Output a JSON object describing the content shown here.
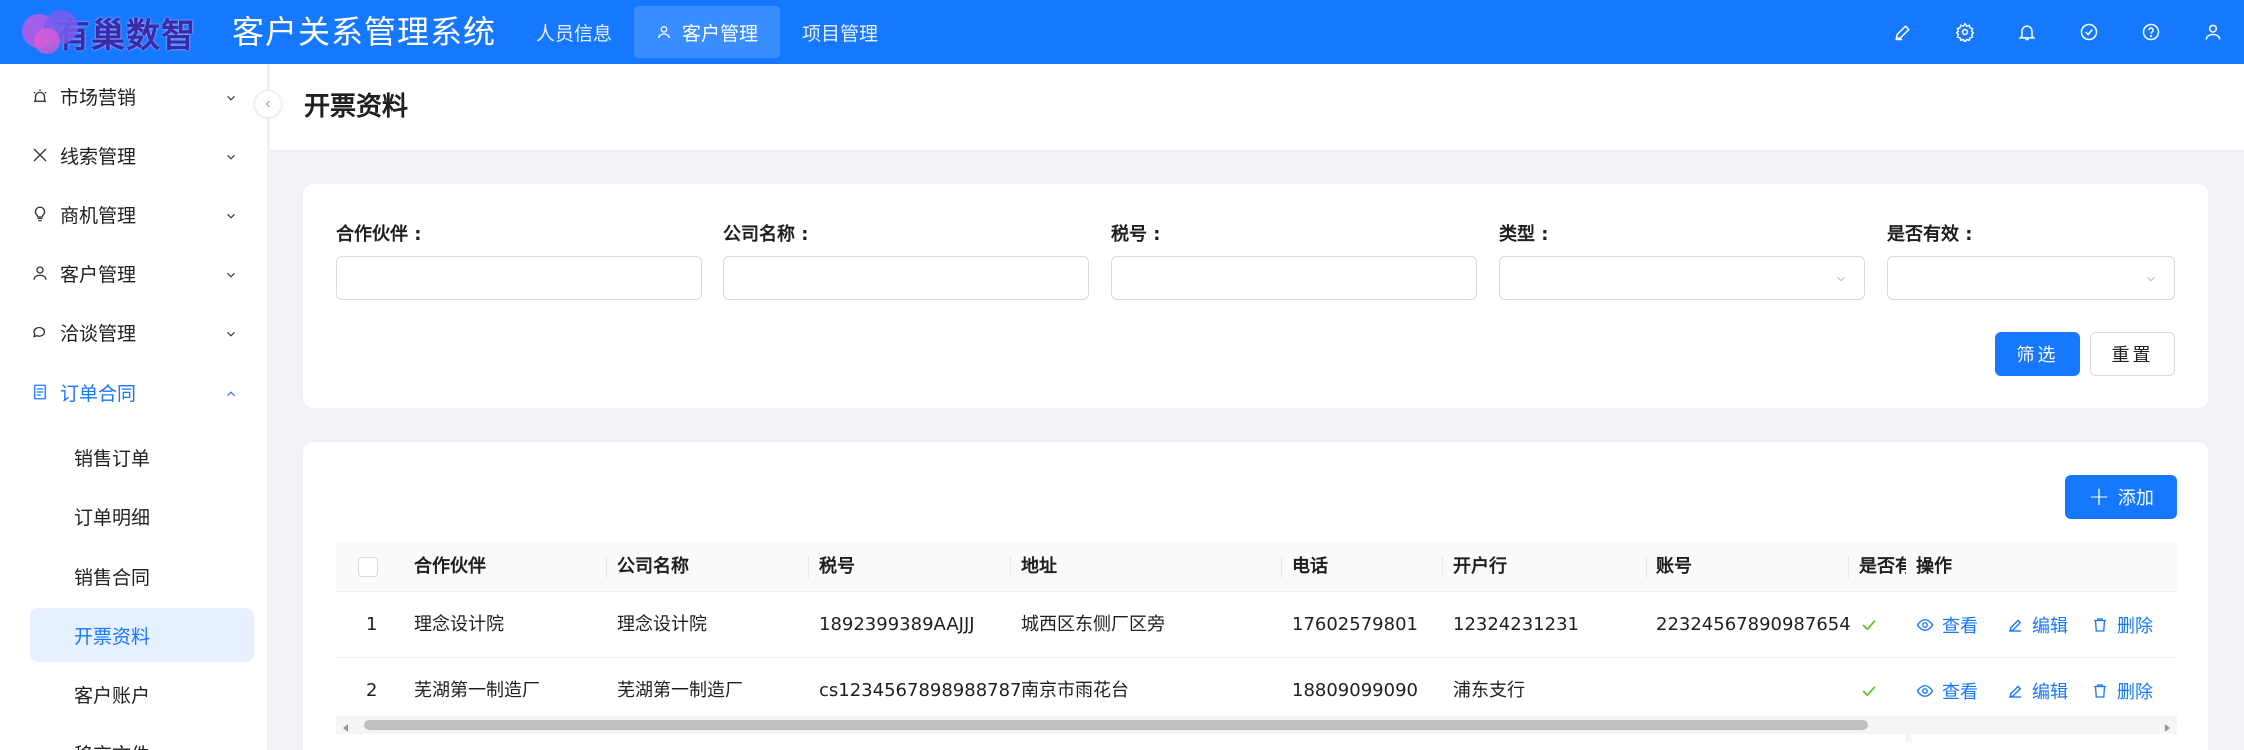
{
  "header": {
    "logo_text": "有巢数智",
    "app_title": "客户关系管理系统",
    "nav": [
      {
        "label": "人员信息"
      },
      {
        "label": "客户管理"
      },
      {
        "label": "项目管理"
      }
    ],
    "icons": [
      "brush-icon",
      "settings-icon",
      "bell-icon",
      "check-circle-icon",
      "help-icon",
      "user-icon"
    ]
  },
  "sidebar": {
    "items": [
      {
        "label": "市场营销",
        "icon": "alarm-icon"
      },
      {
        "label": "线索管理",
        "icon": "x-icon"
      },
      {
        "label": "商机管理",
        "icon": "bulb-icon"
      },
      {
        "label": "客户管理",
        "icon": "user-icon"
      },
      {
        "label": "洽谈管理",
        "icon": "chat-icon"
      },
      {
        "label": "订单合同",
        "icon": "doc-icon"
      }
    ],
    "sub_items": [
      {
        "label": "销售订单"
      },
      {
        "label": "订单明细"
      },
      {
        "label": "销售合同"
      },
      {
        "label": "开票资料"
      },
      {
        "label": "客户账户"
      },
      {
        "label": "移交文件"
      }
    ]
  },
  "page": {
    "title": "开票资料"
  },
  "filters": {
    "partner_label": "合作伙伴 :",
    "company_label": "公司名称 :",
    "tax_label": "税号 :",
    "type_label": "类型 :",
    "valid_label": "是否有效 :",
    "partner_value": "",
    "company_value": "",
    "tax_value": "",
    "type_value": "",
    "valid_value": "",
    "filter_button": "筛选",
    "reset_button": "重置"
  },
  "table": {
    "add_button": "添加",
    "columns": [
      "合作伙伴",
      "公司名称",
      "税号",
      "地址",
      "电话",
      "开户行",
      "账号",
      "是否有效",
      "操作"
    ],
    "rows": [
      {
        "index": "1",
        "partner": "理念设计院",
        "company": "理念设计院",
        "tax": "1892399389AAJJJ",
        "address": "城西区东侧厂区旁",
        "phone": "17602579801",
        "bank": "12324231231",
        "account": "22324567890987654",
        "valid": true
      },
      {
        "index": "2",
        "partner": "芜湖第一制造厂",
        "company": "芜湖第一制造厂",
        "tax": "cs1234567898988787",
        "address": "南京市雨花台",
        "phone": "18809099090",
        "bank": "浦东支行",
        "account": "",
        "valid": true
      }
    ],
    "ops": {
      "view": "查看",
      "edit": "编辑",
      "delete": "删除"
    }
  },
  "colors": {
    "primary": "#1677ff",
    "success": "#52c41a",
    "selected_bg": "#e6f0ff"
  }
}
